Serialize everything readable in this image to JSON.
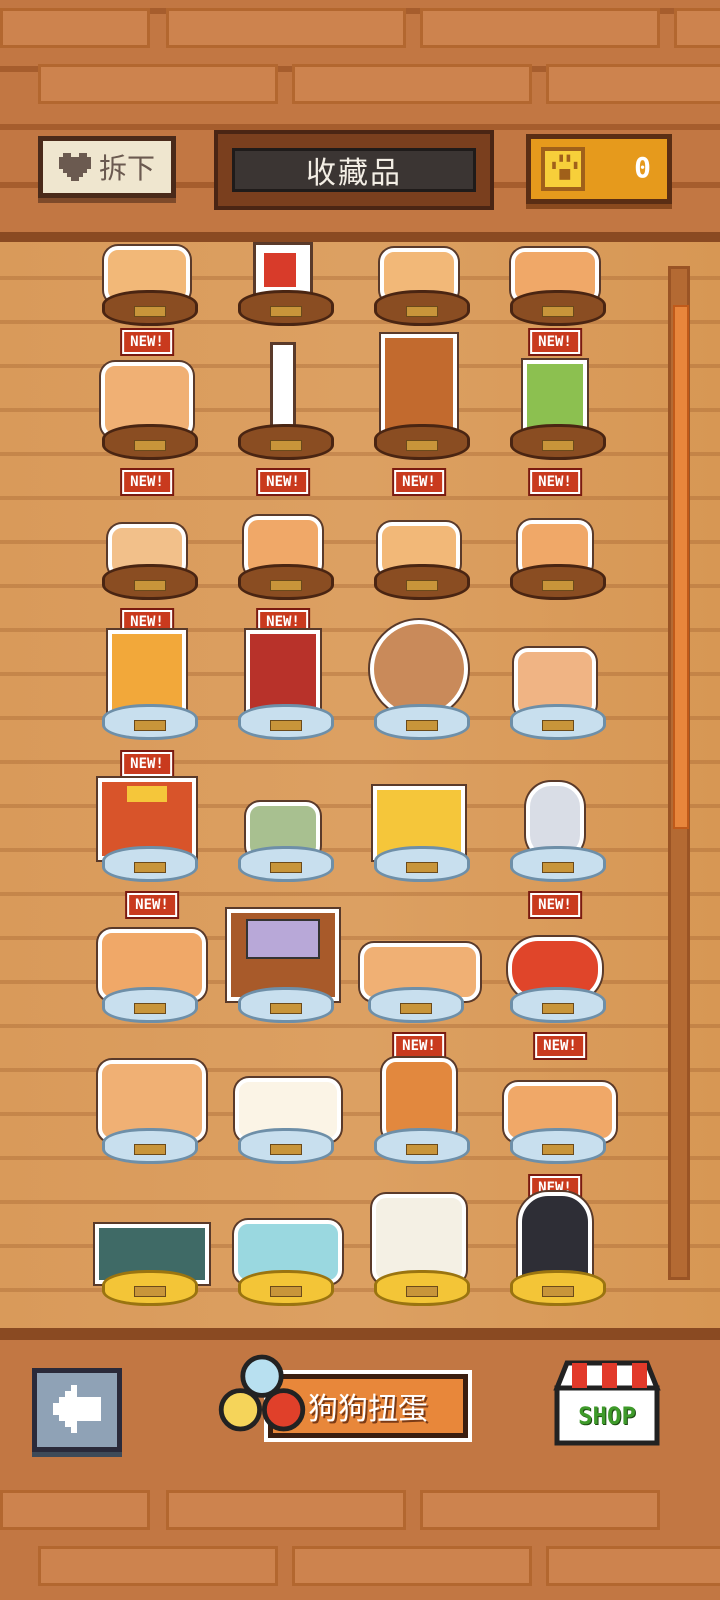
{
  "header": {
    "remove_label": "拆下",
    "title": "收藏品",
    "coins": "0"
  },
  "badges": {
    "new": "NEW!"
  },
  "bottom_bar": {
    "gacha_label": "狗狗扭蛋",
    "shop_label": "SHOP"
  },
  "icons": [
    "heart-icon",
    "coin-paw-icon",
    "back-arrow-icon",
    "capsule-icon",
    "shop-awning-icon"
  ],
  "colors": {
    "new_badge": "#c93a1e",
    "coin_box": "#e69a1c",
    "title_plate": "#3b3533",
    "shop_text": "#3e9a2a"
  }
}
